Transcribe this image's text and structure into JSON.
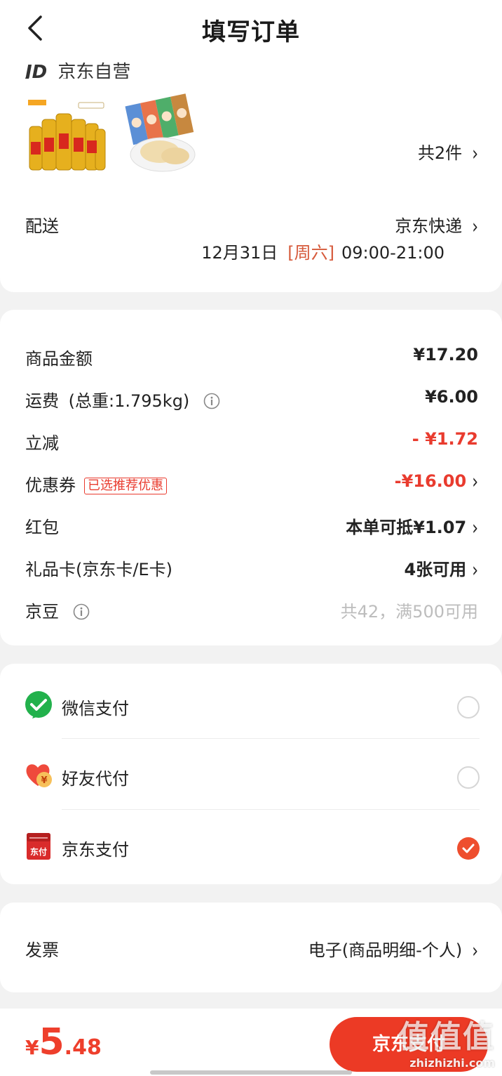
{
  "header": {
    "title": "填写订单"
  },
  "shop": {
    "logo": "JD",
    "name": "京东自营"
  },
  "items": {
    "count_label": "共2件",
    "products": [
      "beverage-bottles",
      "milk-candy"
    ]
  },
  "delivery": {
    "label": "配送",
    "method": "京东快递",
    "date": "12月31日",
    "weekday": "[周六]",
    "time_range": "09:00-21:00"
  },
  "summary": {
    "goods_label": "商品金额",
    "goods_value": "¥17.20",
    "shipping_label": "运费",
    "shipping_weight": "(总重:1.795kg)",
    "shipping_value": "¥6.00",
    "discount_label": "立减",
    "discount_value": "- ¥1.72",
    "coupon_label": "优惠券",
    "coupon_tag": "已选推荐优惠",
    "coupon_value": "-¥16.00",
    "redpacket_label": "红包",
    "redpacket_value": "本单可抵¥1.07",
    "giftcard_label": "礼品卡(京东卡/E卡)",
    "giftcard_value": "4张可用",
    "jingdou_label": "京豆",
    "jingdou_value": "共42，满500可用"
  },
  "payment": {
    "options": [
      {
        "label": "微信支付",
        "icon": "wechat-pay-icon",
        "selected": false
      },
      {
        "label": "好友代付",
        "icon": "friend-pay-icon",
        "selected": false
      },
      {
        "label": "京东支付",
        "icon": "jd-pay-icon",
        "selected": true
      }
    ],
    "jd_icon_text": "东付"
  },
  "invoice": {
    "label": "发票",
    "value": "电子(商品明细-个人)"
  },
  "footer": {
    "currency": "¥",
    "total_int": "5",
    "total_dec": ".48",
    "pay_button": "京东支付"
  },
  "watermark": {
    "big": "值值值",
    "small": "zhizhizhi.com"
  },
  "colors": {
    "accent": "#ec3a25",
    "discount": "#e93b2e",
    "weekday": "#d65a3b"
  }
}
